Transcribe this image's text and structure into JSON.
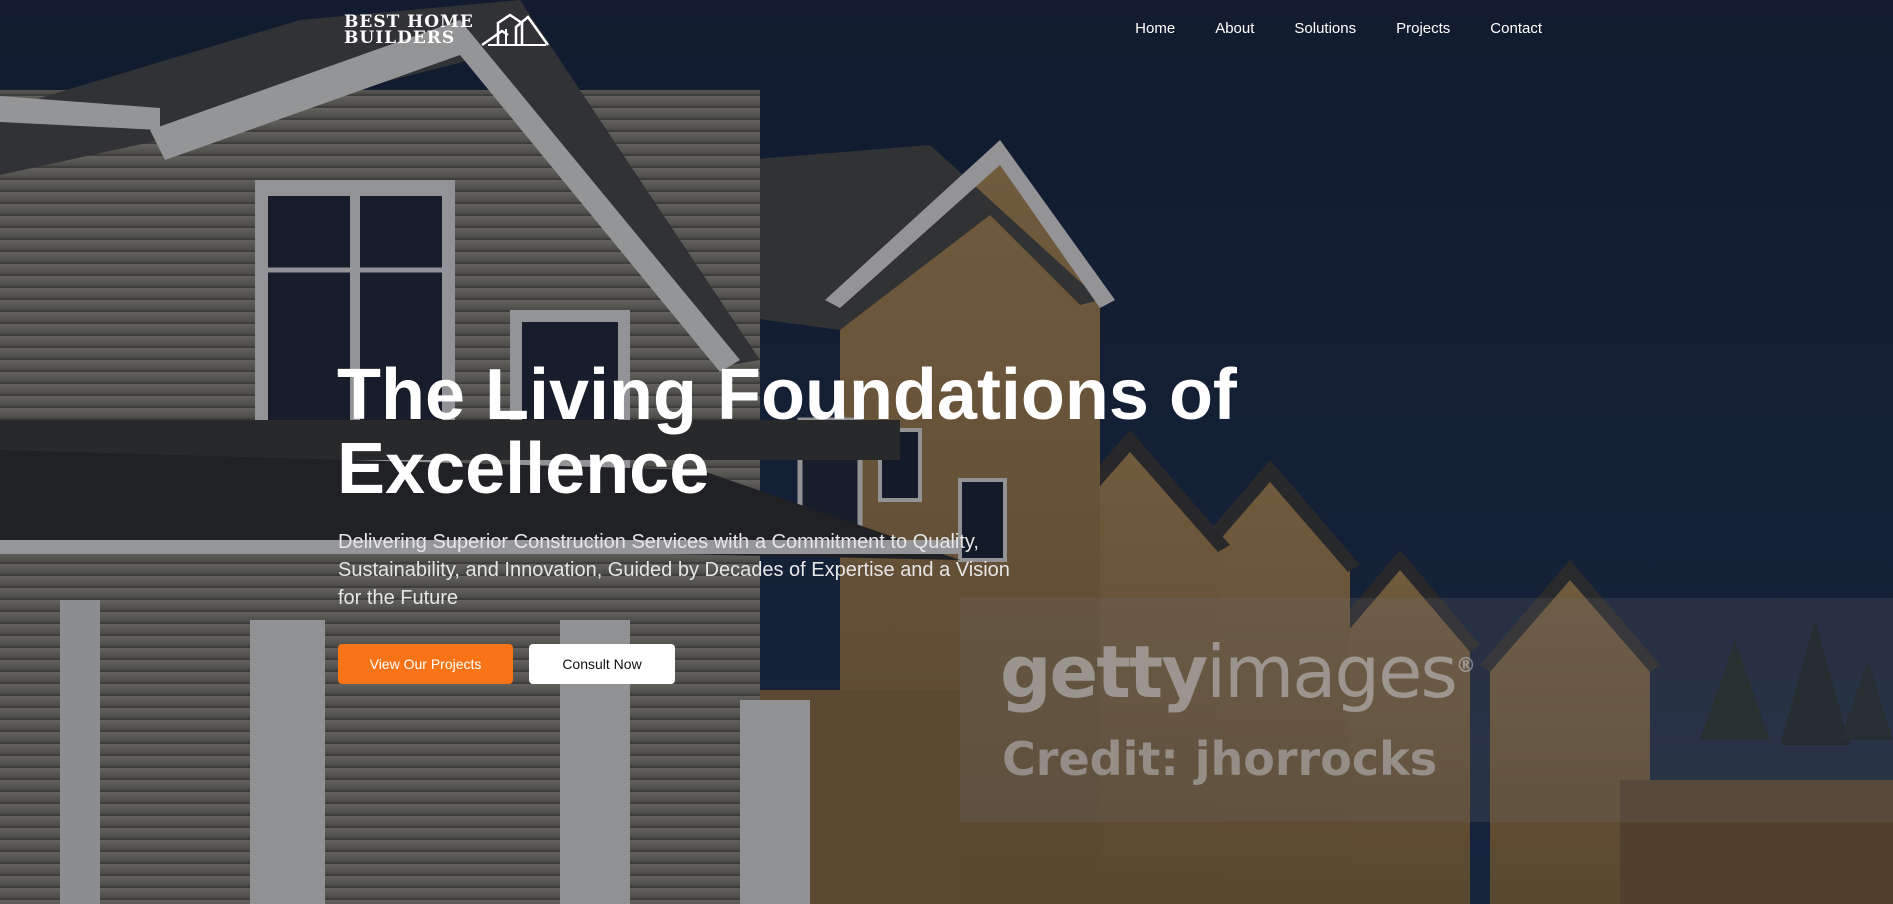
{
  "header": {
    "logo": {
      "line1": "BEST HOME",
      "line2": "BUILDERS"
    },
    "nav": [
      "Home",
      "About",
      "Solutions",
      "Projects",
      "Contact"
    ]
  },
  "hero": {
    "title_line1": "The Living Foundations of",
    "title_line2": "Excellence",
    "subtitle": "Delivering Superior Construction Services with a Commitment to Quality, Sustainability, and Innovation, Guided by Decades of Expertise and a Vision for the Future",
    "primary_button": "View Our Projects",
    "secondary_button": "Consult Now"
  },
  "watermark": {
    "brand_bold": "getty",
    "brand_light": "images",
    "registered": "®",
    "credit": "Credit: jhorrocks"
  },
  "colors": {
    "accent": "#f97416",
    "sky": "#142238",
    "text": "#ffffff"
  }
}
